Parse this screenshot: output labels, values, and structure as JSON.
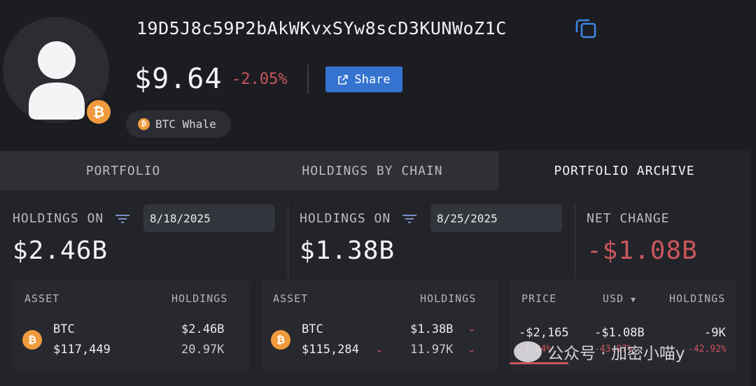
{
  "header": {
    "address": "19D5J8c59P2bAkWKvxSYw8scD3KUNWoZ1C",
    "value": "$9.64",
    "change_pct": "-2.05%",
    "share_label": "Share",
    "tag_label": "BTC Whale",
    "badge_glyph": "₿"
  },
  "tabs": [
    {
      "label": "PORTFOLIO",
      "active": false
    },
    {
      "label": "HOLDINGS BY CHAIN",
      "active": false
    },
    {
      "label": "PORTFOLIO ARCHIVE",
      "active": true
    }
  ],
  "summary": {
    "left": {
      "label": "HOLDINGS ON",
      "date": "8/18/2025",
      "value": "$2.46B"
    },
    "middle": {
      "label": "HOLDINGS ON",
      "date": "8/25/2025",
      "value": "$1.38B"
    },
    "right": {
      "label": "NET CHANGE",
      "value": "-$1.08B"
    }
  },
  "tables": {
    "left": {
      "headers": [
        "ASSET",
        "HOLDINGS"
      ],
      "row": {
        "symbol": "BTC",
        "price": "$117,449",
        "usd": "$2.46B",
        "amount": "20.97K"
      }
    },
    "middle": {
      "headers": [
        "ASSET",
        "HOLDINGS"
      ],
      "row": {
        "symbol": "BTC",
        "price": "$115,284",
        "usd": "$1.38B",
        "amount": "11.97K"
      }
    },
    "right": {
      "headers": [
        "PRICE",
        "USD",
        "HOLDINGS"
      ],
      "row": {
        "price": "-$2,165",
        "usd": "-$1.08B",
        "holdings": "-9K",
        "price_pct": "-1.84%",
        "usd_pct": "-43.97%",
        "holdings_pct": "-42.92%"
      }
    }
  },
  "watermark": "公众号 · 加密小喵y",
  "colors": {
    "background": "#1c1d22",
    "accent": "#3473cf",
    "negative": "#c9565c",
    "bitcoin": "#ef9a3c"
  }
}
